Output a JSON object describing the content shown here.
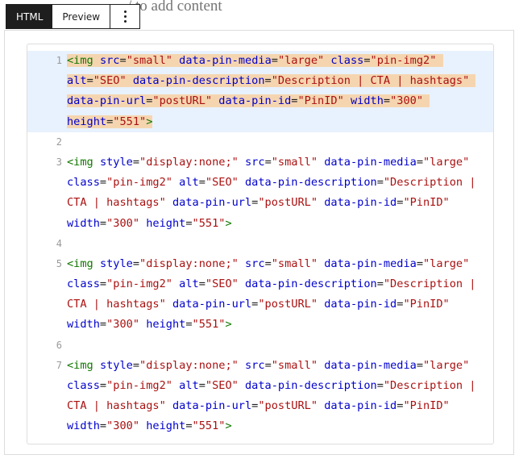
{
  "page": {
    "behind_text": "/ to add content"
  },
  "toolbar": {
    "tabs": [
      {
        "label": "HTML"
      },
      {
        "label": "Preview"
      }
    ],
    "more_icon": "vertical-ellipsis-icon"
  },
  "editor": {
    "line_numbers": [
      "1",
      "2",
      "3",
      "4",
      "5",
      "6",
      "7"
    ],
    "lines": [
      {
        "rows": [
          [
            [
              "t",
              "<img"
            ],
            [
              "p",
              " "
            ],
            [
              "a",
              "src"
            ],
            [
              "p",
              "="
            ],
            [
              "s",
              "\"small\""
            ],
            [
              "p",
              " "
            ],
            [
              "a",
              "data-pin-media"
            ],
            [
              "p",
              "="
            ],
            [
              "s",
              "\"large\""
            ],
            [
              "p",
              " "
            ],
            [
              "a",
              "class"
            ],
            [
              "p",
              "="
            ],
            [
              "s",
              "\"pin-img2\""
            ],
            [
              "p",
              " "
            ]
          ],
          [
            [
              "a",
              "alt"
            ],
            [
              "p",
              "="
            ],
            [
              "s",
              "\"SEO\""
            ],
            [
              "p",
              " "
            ],
            [
              "a",
              "data-pin-description"
            ],
            [
              "p",
              "="
            ],
            [
              "s",
              "\"Description | CTA | hashtags\""
            ],
            [
              "p",
              " "
            ]
          ],
          [
            [
              "a",
              "data-pin-url"
            ],
            [
              "p",
              "="
            ],
            [
              "s",
              "\"postURL\""
            ],
            [
              "p",
              " "
            ],
            [
              "a",
              "data-pin-id"
            ],
            [
              "p",
              "="
            ],
            [
              "s",
              "\"PinID\""
            ],
            [
              "p",
              " "
            ],
            [
              "a",
              "width"
            ],
            [
              "p",
              "="
            ],
            [
              "s",
              "\"300\""
            ],
            [
              "p",
              " "
            ]
          ],
          [
            [
              "a",
              "height"
            ],
            [
              "p",
              "="
            ],
            [
              "s",
              "\"551\""
            ],
            [
              "t",
              ">"
            ]
          ]
        ]
      },
      {
        "rows": []
      },
      {
        "rows": [
          [
            [
              "t",
              "<img"
            ],
            [
              "p",
              " "
            ],
            [
              "a",
              "style"
            ],
            [
              "p",
              "="
            ],
            [
              "s",
              "\"display:none;\""
            ],
            [
              "p",
              " "
            ],
            [
              "a",
              "src"
            ],
            [
              "p",
              "="
            ],
            [
              "s",
              "\"small\""
            ],
            [
              "p",
              " "
            ],
            [
              "a",
              "data-pin-media"
            ],
            [
              "p",
              "="
            ],
            [
              "s",
              "\"large\""
            ]
          ],
          [
            [
              "a",
              "class"
            ],
            [
              "p",
              "="
            ],
            [
              "s",
              "\"pin-img2\""
            ],
            [
              "p",
              " "
            ],
            [
              "a",
              "alt"
            ],
            [
              "p",
              "="
            ],
            [
              "s",
              "\"SEO\""
            ],
            [
              "p",
              " "
            ],
            [
              "a",
              "data-pin-description"
            ],
            [
              "p",
              "="
            ],
            [
              "s",
              "\"Description |"
            ]
          ],
          [
            [
              "s",
              "CTA | hashtags\""
            ],
            [
              "p",
              " "
            ],
            [
              "a",
              "data-pin-url"
            ],
            [
              "p",
              "="
            ],
            [
              "s",
              "\"postURL\""
            ],
            [
              "p",
              " "
            ],
            [
              "a",
              "data-pin-id"
            ],
            [
              "p",
              "="
            ],
            [
              "s",
              "\"PinID\""
            ]
          ],
          [
            [
              "a",
              "width"
            ],
            [
              "p",
              "="
            ],
            [
              "s",
              "\"300\""
            ],
            [
              "p",
              " "
            ],
            [
              "a",
              "height"
            ],
            [
              "p",
              "="
            ],
            [
              "s",
              "\"551\""
            ],
            [
              "t",
              ">"
            ]
          ]
        ]
      },
      {
        "rows": []
      },
      {
        "rows": [
          [
            [
              "t",
              "<img"
            ],
            [
              "p",
              " "
            ],
            [
              "a",
              "style"
            ],
            [
              "p",
              "="
            ],
            [
              "s",
              "\"display:none;\""
            ],
            [
              "p",
              " "
            ],
            [
              "a",
              "src"
            ],
            [
              "p",
              "="
            ],
            [
              "s",
              "\"small\""
            ],
            [
              "p",
              " "
            ],
            [
              "a",
              "data-pin-media"
            ],
            [
              "p",
              "="
            ],
            [
              "s",
              "\"large\""
            ]
          ],
          [
            [
              "a",
              "class"
            ],
            [
              "p",
              "="
            ],
            [
              "s",
              "\"pin-img2\""
            ],
            [
              "p",
              " "
            ],
            [
              "a",
              "alt"
            ],
            [
              "p",
              "="
            ],
            [
              "s",
              "\"SEO\""
            ],
            [
              "p",
              " "
            ],
            [
              "a",
              "data-pin-description"
            ],
            [
              "p",
              "="
            ],
            [
              "s",
              "\"Description |"
            ]
          ],
          [
            [
              "s",
              "CTA | hashtags\""
            ],
            [
              "p",
              " "
            ],
            [
              "a",
              "data-pin-url"
            ],
            [
              "p",
              "="
            ],
            [
              "s",
              "\"postURL\""
            ],
            [
              "p",
              " "
            ],
            [
              "a",
              "data-pin-id"
            ],
            [
              "p",
              "="
            ],
            [
              "s",
              "\"PinID\""
            ]
          ],
          [
            [
              "a",
              "width"
            ],
            [
              "p",
              "="
            ],
            [
              "s",
              "\"300\""
            ],
            [
              "p",
              " "
            ],
            [
              "a",
              "height"
            ],
            [
              "p",
              "="
            ],
            [
              "s",
              "\"551\""
            ],
            [
              "t",
              ">"
            ]
          ]
        ]
      },
      {
        "rows": []
      },
      {
        "rows": [
          [
            [
              "t",
              "<img"
            ],
            [
              "p",
              " "
            ],
            [
              "a",
              "style"
            ],
            [
              "p",
              "="
            ],
            [
              "s",
              "\"display:none;\""
            ],
            [
              "p",
              " "
            ],
            [
              "a",
              "src"
            ],
            [
              "p",
              "="
            ],
            [
              "s",
              "\"small\""
            ],
            [
              "p",
              " "
            ],
            [
              "a",
              "data-pin-media"
            ],
            [
              "p",
              "="
            ],
            [
              "s",
              "\"large\""
            ]
          ],
          [
            [
              "a",
              "class"
            ],
            [
              "p",
              "="
            ],
            [
              "s",
              "\"pin-img2\""
            ],
            [
              "p",
              " "
            ],
            [
              "a",
              "alt"
            ],
            [
              "p",
              "="
            ],
            [
              "s",
              "\"SEO\""
            ],
            [
              "p",
              " "
            ],
            [
              "a",
              "data-pin-description"
            ],
            [
              "p",
              "="
            ],
            [
              "s",
              "\"Description |"
            ]
          ],
          [
            [
              "s",
              "CTA | hashtags\""
            ],
            [
              "p",
              " "
            ],
            [
              "a",
              "data-pin-url"
            ],
            [
              "p",
              "="
            ],
            [
              "s",
              "\"postURL\""
            ],
            [
              "p",
              " "
            ],
            [
              "a",
              "data-pin-id"
            ],
            [
              "p",
              "="
            ],
            [
              "s",
              "\"PinID\""
            ]
          ],
          [
            [
              "a",
              "width"
            ],
            [
              "p",
              "="
            ],
            [
              "s",
              "\"300\""
            ],
            [
              "p",
              " "
            ],
            [
              "a",
              "height"
            ],
            [
              "p",
              "="
            ],
            [
              "s",
              "\"551\""
            ],
            [
              "t",
              ">"
            ]
          ]
        ]
      }
    ],
    "colors": {
      "tag": "#117700",
      "attribute": "#0000cc",
      "string": "#aa1111",
      "active_line_bg": "#e8f2fe",
      "selection_bg": "#f5d5b0"
    }
  }
}
